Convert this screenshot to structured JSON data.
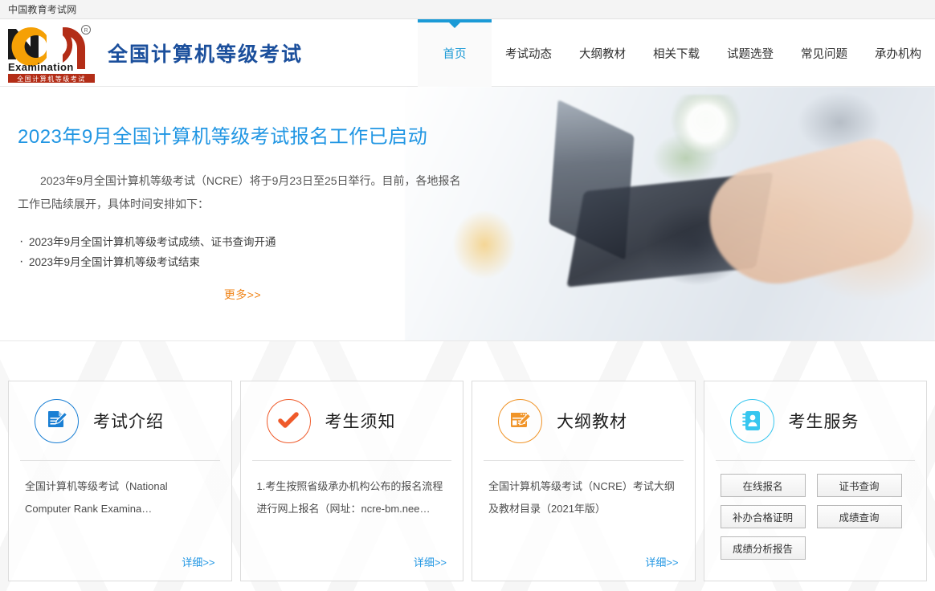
{
  "topbar": {
    "site_name": "中国教育考试网"
  },
  "header": {
    "logo": {
      "letters": "NCR",
      "sub_en": "Examination",
      "band_cn": "全国计算机等级考试",
      "registered": "®"
    },
    "brand_title": "全国计算机等级考试",
    "brand_color": "#1b4f9c"
  },
  "nav": {
    "active_index": 0,
    "accent": "#1b9ad6",
    "items": [
      {
        "label": "首页"
      },
      {
        "label": "考试动态"
      },
      {
        "label": "大纲教材"
      },
      {
        "label": "相关下载"
      },
      {
        "label": "试题选登"
      },
      {
        "label": "常见问题"
      },
      {
        "label": "承办机构"
      }
    ]
  },
  "banner": {
    "heading": "2023年9月全国计算机等级考试报名工作已启动",
    "heading_color": "#2196e3",
    "paragraph": "2023年9月全国计算机等级考试（NCRE）将于9月23日至25日举行。目前，各地报名工作已陆续展开，具体时间安排如下：",
    "list": [
      {
        "label": "2023年9月全国计算机等级考试成绩、证书查询开通"
      },
      {
        "label": "2023年9月全国计算机等级考试结束"
      }
    ],
    "more_label": "更多>>",
    "more_color": "#f08519"
  },
  "cards": [
    {
      "icon": "document-pen-icon",
      "color": "#1a7fd4",
      "title": "考试介绍",
      "desc": "全国计算机等级考试（National Computer Rank Examina…",
      "detail_label": "详细>>"
    },
    {
      "icon": "check-mark-icon",
      "color": "#ef5a2a",
      "title": "考生须知",
      "desc": "1.考生按照省级承办机构公布的报名流程进行网上报名（网址：ncre-bm.nee…",
      "detail_label": "详细>>"
    },
    {
      "icon": "syllabus-pen-icon",
      "color": "#f09428",
      "title": "大纲教材",
      "desc": "全国计算机等级考试（NCRE）考试大纲及教材目录（2021年版）",
      "detail_label": "详细>>"
    },
    {
      "icon": "contact-book-icon",
      "color": "#36c6ef",
      "title": "考生服务",
      "buttons": [
        {
          "label": "在线报名"
        },
        {
          "label": "证书查询"
        },
        {
          "label": "补办合格证明"
        },
        {
          "label": "成绩查询"
        },
        {
          "label": "成绩分析报告"
        }
      ]
    }
  ]
}
